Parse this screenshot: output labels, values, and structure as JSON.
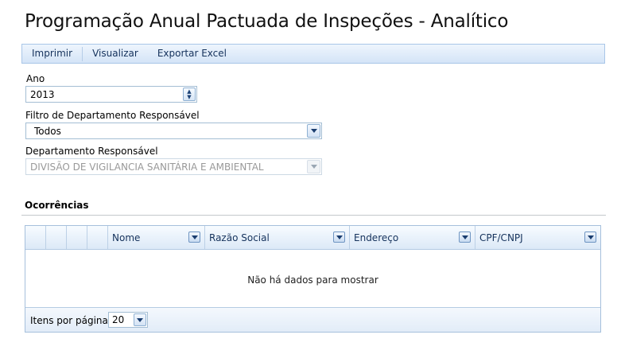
{
  "page": {
    "title": "Programação Anual Pactuada de Inspeções - Analítico"
  },
  "toolbar": {
    "print_label": "Imprimir",
    "view_label": "Visualizar",
    "export_label": "Exportar Excel"
  },
  "form": {
    "year": {
      "label": "Ano",
      "value": "2013"
    },
    "dept_filter": {
      "label": "Filtro de Departamento Responsável",
      "value": "Todos"
    },
    "dept": {
      "label": "Departamento Responsável",
      "value": "DIVISÃO DE VIGILANCIA SANITÁRIA E AMBIENTAL"
    }
  },
  "occurrences": {
    "title": "Ocorrências",
    "columns": [
      "Nome",
      "Razão Social",
      "Endereço",
      "CPF/CNPJ"
    ],
    "empty_text": "Não há dados para mostrar",
    "pager": {
      "label": "Itens por página:",
      "value": "20"
    }
  }
}
